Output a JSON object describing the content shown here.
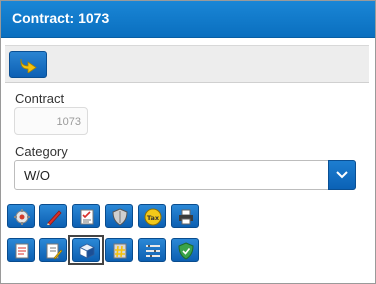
{
  "window": {
    "title": "Contract: 1073"
  },
  "toolbar": {
    "back_icon": "yellow-return-arrow-icon"
  },
  "contract": {
    "label": "Contract",
    "value": "1073"
  },
  "category": {
    "label": "Category",
    "selected": "W/O"
  },
  "action_buttons_row1": [
    {
      "icon": "gear-settings-icon"
    },
    {
      "icon": "pencil-edit-icon"
    },
    {
      "icon": "checklist-document-icon"
    },
    {
      "icon": "shield-icon"
    },
    {
      "icon": "tax-coin-icon",
      "text": "Tax"
    },
    {
      "icon": "printer-icon"
    }
  ],
  "action_buttons_row2": [
    {
      "icon": "document-list-icon"
    },
    {
      "icon": "document-pencil-icon"
    },
    {
      "icon": "cube-box-icon",
      "selected": true
    },
    {
      "icon": "hash-document-icon"
    },
    {
      "icon": "list-lines-icon"
    },
    {
      "icon": "green-shield-icon"
    }
  ],
  "colors": {
    "titlebar": "#0a6fbf",
    "button_blue": "#1a74c6",
    "arrow_yellow": "#f4c20d"
  }
}
